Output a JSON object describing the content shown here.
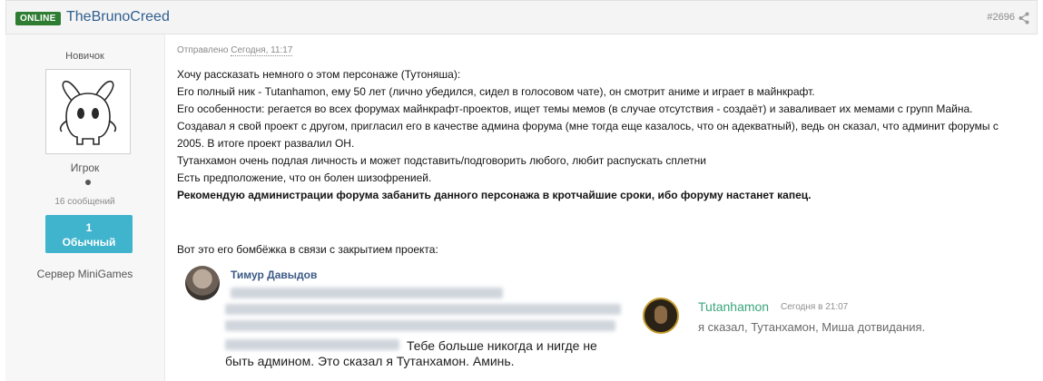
{
  "header": {
    "online_badge": "ONLINE",
    "username": "TheBrunoCreed",
    "post_number": "#2696",
    "share_icon": "share-icon"
  },
  "sidebar": {
    "rank": "Новичок",
    "role": "Игрок",
    "messages": "16 сообщений",
    "level_number": "1",
    "level_name": "Обычный",
    "server_label": "Сервер",
    "server_name": "MiniGames",
    "avatar_icon": "rabbit-avatar-icon"
  },
  "post": {
    "sent_label": "Отправлено",
    "sent_date": "Сегодня, 11:17",
    "lines": [
      "Хочу рассказать немного о этом персонаже (Тутоняша):",
      "Его полный ник - Tutanhamon, ему 50 лет (лично убедился, сидел в голосовом чате), он смотрит аниме и играет в майнкрафт.",
      "Его особенности: регается во всех форумах майнкрафт-проектов, ищет темы мемов (в случае отсутствия - создаёт) и заваливает их мемами с групп Майна.",
      "Создавал я свой проект с другом, пригласил его в качестве админа форума (мне тогда еще казалось, что он адекватный), ведь он сказал, что админит форумы с",
      "2005. В итоге проект развалил ОН.",
      "Тутанхамон очень подлая личность и может подставить/подговорить любого, любит распускать сплетни",
      "Есть предположение, что он болен шизофренией.",
      "Рекомендую администрации форума забанить данного персонажа в кротчайшие сроки, ибо форуму настанет капец."
    ],
    "intro_text": "Вот это его бомбёжка в связи с закрытием проекта:"
  },
  "screenshot1": {
    "sender": "Тимур Давыдов",
    "visible_line1": "Тебе больше никогда и нигде не",
    "visible_line2": "быть админом. Это сказал я Тутанхамон. Аминь."
  },
  "screenshot2": {
    "sender": "Tutanhamon",
    "time": "Сегодня в 21:07",
    "message": "я сказал, Тутанхамон, Миша дотвидания."
  },
  "colors": {
    "online": "#2e7d32",
    "username": "#2f5f8f",
    "level_badge": "#3fb4cc",
    "discord_name": "#3aa67c"
  }
}
